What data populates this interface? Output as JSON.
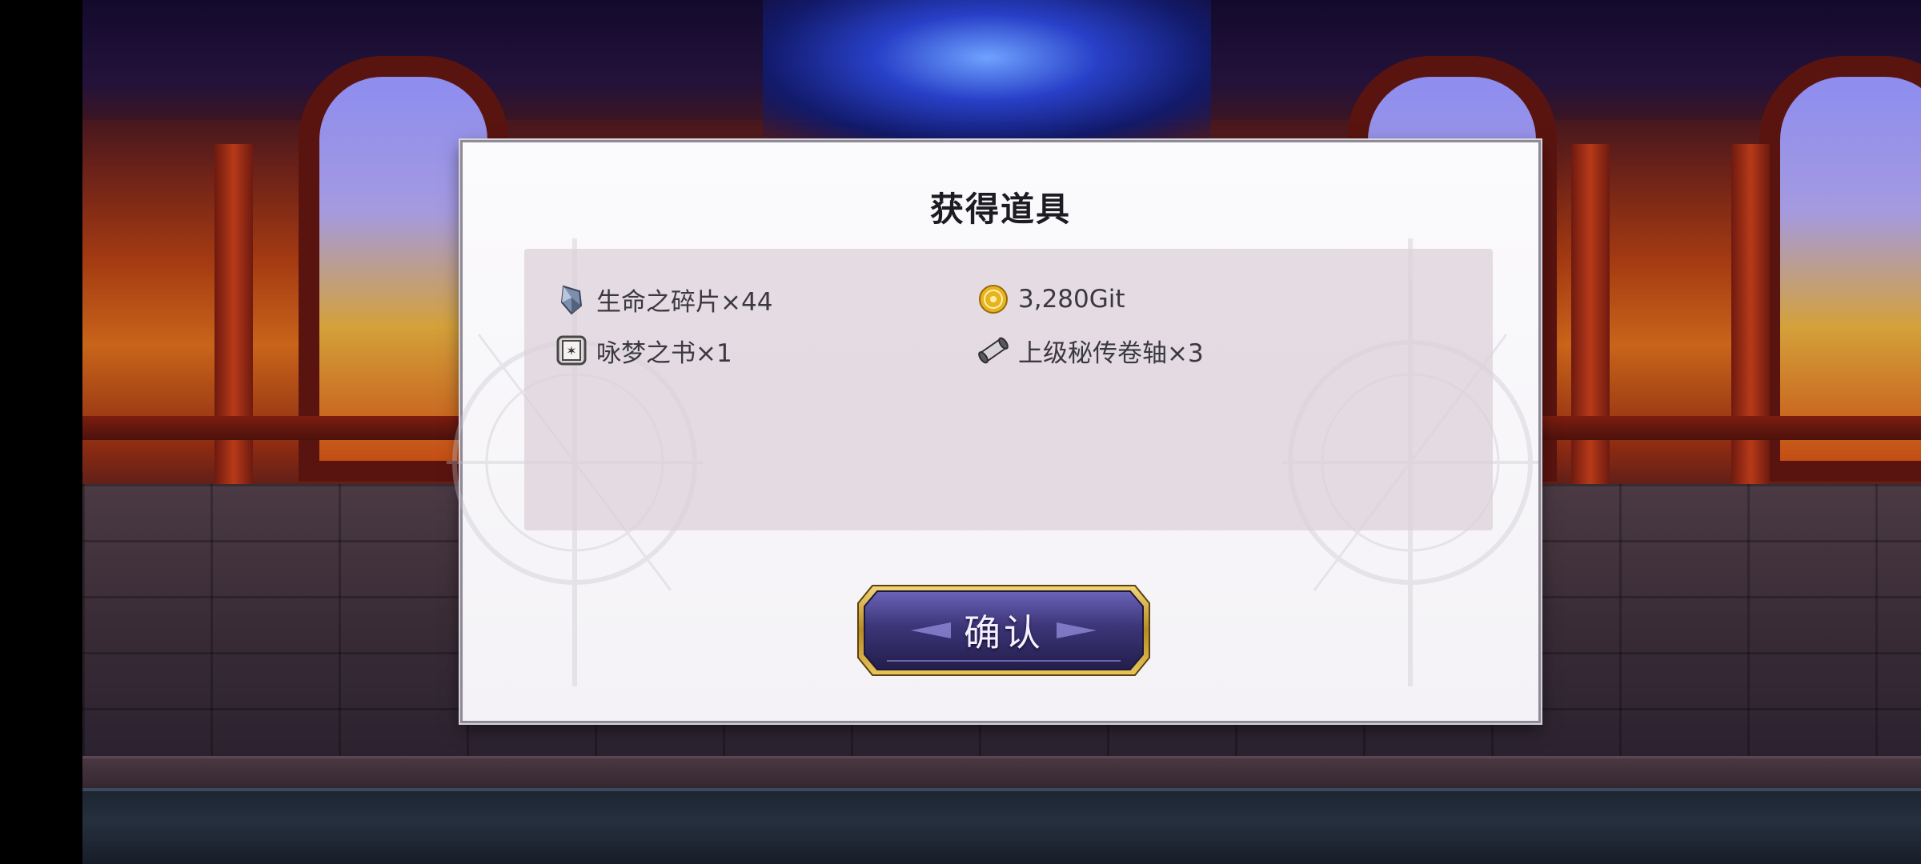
{
  "dialog": {
    "title": "获得道具",
    "items": [
      {
        "icon": "crystal-shard-icon",
        "label": "生命之碎片×44"
      },
      {
        "icon": "gold-coin-icon",
        "label": "3,280Git"
      },
      {
        "icon": "spell-book-icon",
        "label": "咏梦之书×1"
      },
      {
        "icon": "scroll-icon",
        "label": "上级秘传卷轴×3"
      }
    ],
    "confirm_label": "确认"
  },
  "colors": {
    "dialog_bg": "#f6f4f8",
    "panel_bg": "#e6dde3",
    "button_frame": "#c9a43c",
    "button_fill": "#3e3878"
  }
}
